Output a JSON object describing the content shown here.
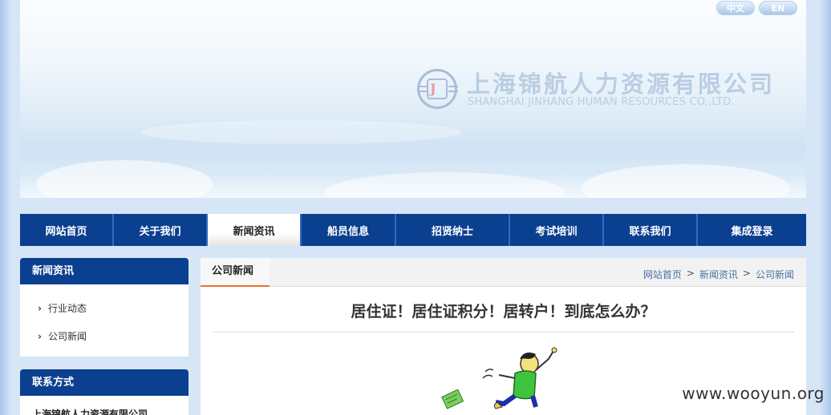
{
  "header": {
    "lang_cn": "中文",
    "lang_en": "EN",
    "brand_cn": "上海锦航人力资源有限公司",
    "brand_en": "SHANGHAI JINHANG HUMAN RESOURCES CO.,LTD."
  },
  "nav": {
    "items": [
      {
        "label": "网站首页"
      },
      {
        "label": "关于我们"
      },
      {
        "label": "新闻资讯"
      },
      {
        "label": "船员信息"
      },
      {
        "label": "招贤纳士"
      },
      {
        "label": "考试培训"
      },
      {
        "label": "联系我们"
      },
      {
        "label": "集成登录"
      }
    ],
    "active_index": 2
  },
  "sidebar": {
    "news_title": "新闻资讯",
    "links": [
      {
        "label": "行业动态"
      },
      {
        "label": "公司新闻"
      }
    ],
    "contact_title": "联系方式",
    "contact_company": "上海锦航人力资源有限公司"
  },
  "main": {
    "tab_label": "公司新闻",
    "breadcrumb": [
      "网站首页",
      "新闻资讯",
      "公司新闻"
    ],
    "breadcrumb_sep": ">",
    "article_title": "居住证！居住证积分！居转户！到底怎么办？"
  },
  "watermark": "www.wooyun.org",
  "colors": {
    "nav_blue": "#0b3f8f",
    "accent_orange": "#e8732d",
    "page_bg": "#c9dcf0"
  }
}
